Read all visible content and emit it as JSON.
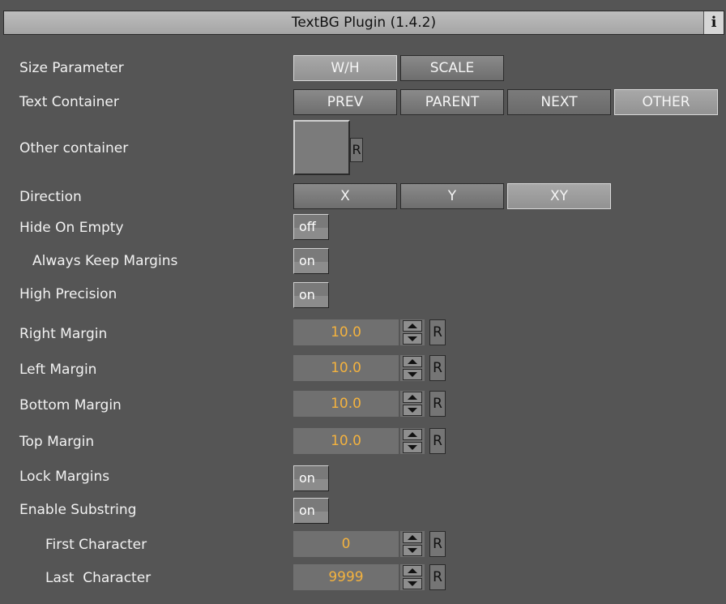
{
  "window": {
    "title": "TextBG Plugin (1.4.2)",
    "info_icon": "info-icon",
    "info_glyph": "i"
  },
  "rows": {
    "size_parameter": {
      "label": "Size Parameter",
      "options": [
        "W/H",
        "SCALE"
      ],
      "selected": "W/H"
    },
    "text_container": {
      "label": "Text Container",
      "options": [
        "PREV",
        "PARENT",
        "NEXT",
        "OTHER"
      ],
      "selected": "OTHER"
    },
    "other_container": {
      "label": "Other container",
      "reset": "R"
    },
    "direction": {
      "label": "Direction",
      "options": [
        "X",
        "Y",
        "XY"
      ],
      "selected": "XY"
    },
    "hide_on_empty": {
      "label": "Hide On Empty",
      "value": "off"
    },
    "always_keep_margins": {
      "label": "Always Keep Margins",
      "value": "on"
    },
    "high_precision": {
      "label": "High Precision",
      "value": "on"
    },
    "right_margin": {
      "label": "Right Margin",
      "value": "10.0",
      "reset": "R"
    },
    "left_margin": {
      "label": "Left Margin",
      "value": "10.0",
      "reset": "R"
    },
    "bottom_margin": {
      "label": "Bottom Margin",
      "value": "10.0",
      "reset": "R"
    },
    "top_margin": {
      "label": "Top Margin",
      "value": "10.0",
      "reset": "R"
    },
    "lock_margins": {
      "label": "Lock Margins",
      "value": "on"
    },
    "enable_substring": {
      "label": "Enable Substring",
      "value": "on"
    },
    "first_character": {
      "label": "First Character",
      "value": "0",
      "reset": "R"
    },
    "last_character": {
      "label": "Last  Character",
      "value": "9999",
      "reset": "R"
    }
  },
  "colors": {
    "background": "#555555",
    "value_text": "#f3b23f",
    "title_bar": "#b0b0b0"
  }
}
